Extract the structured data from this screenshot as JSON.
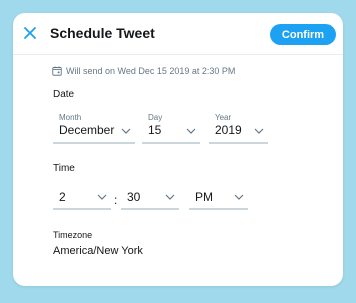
{
  "header": {
    "title": "Schedule Tweet",
    "confirm_label": "Confirm"
  },
  "will_send": "Will send on Wed Dec 15 2019 at 2:30 PM",
  "date": {
    "section_label": "Date",
    "month": {
      "label": "Month",
      "value": "December"
    },
    "day": {
      "label": "Day",
      "value": "15"
    },
    "year": {
      "label": "Year",
      "value": "2019"
    }
  },
  "time": {
    "section_label": "Time",
    "hour": "2",
    "minute": "30",
    "separator": ":",
    "period": "PM"
  },
  "timezone": {
    "label": "Timezone",
    "value": "America/New York"
  },
  "colors": {
    "background": "#9fd9eb",
    "accent": "#1da1f2",
    "text": "#14171a",
    "muted": "#657786",
    "border": "#ccd6dd"
  },
  "icons": [
    "close-icon",
    "calendar-icon",
    "chevron-down-icon"
  ]
}
